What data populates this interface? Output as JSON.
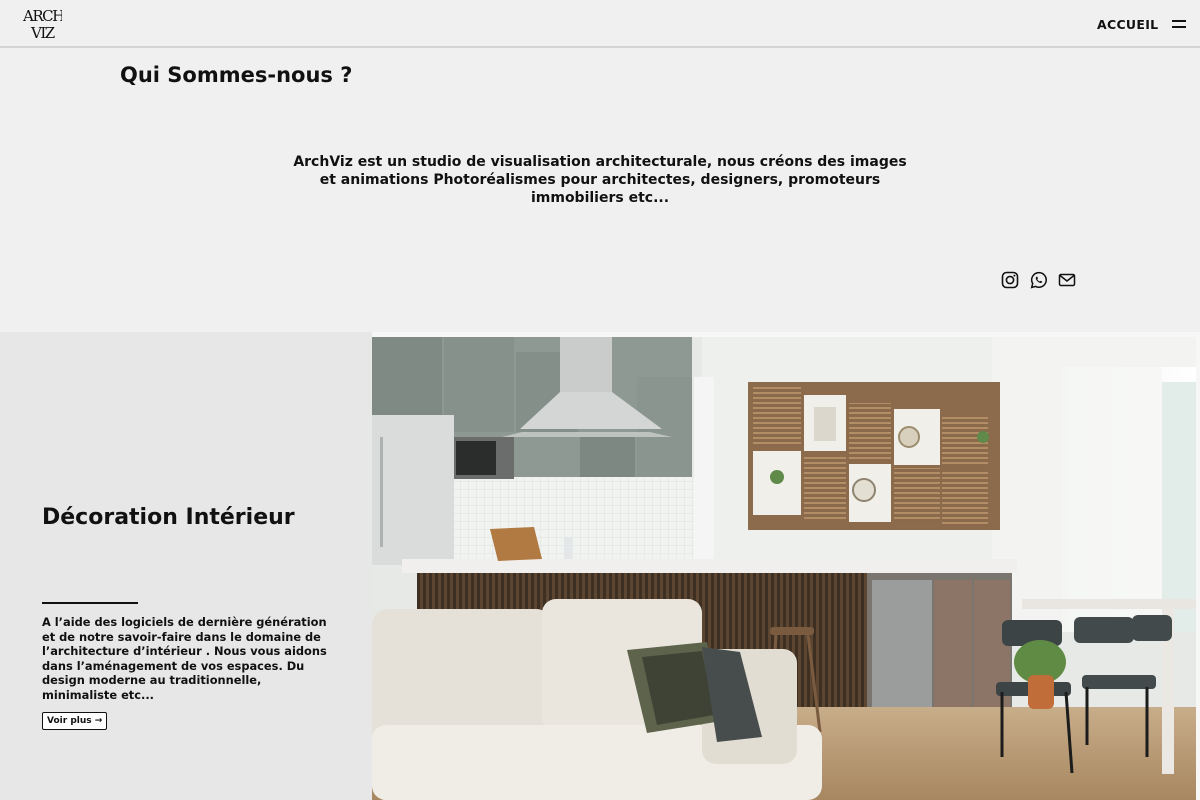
{
  "header": {
    "logo_text": "ARCH VIZ",
    "nav_link": "ACCUEIL",
    "menu_icon": "hamburger-icon"
  },
  "about": {
    "title": "Qui Sommes-nous ?",
    "text_lines": [
      "ArchViz est un studio de visualisation architecturale, nous créons des images",
      "et animations Photoréalismes pour architectes, designers, promoteurs",
      "immobiliers etc..."
    ],
    "social_icons": [
      "instagram-icon",
      "whatsapp-icon",
      "mail-icon"
    ]
  },
  "services": {
    "title": "Décoration Intérieur",
    "text_lines": [
      "A l’aide des logiciels de dernière génération",
      "et de notre savoir-faire dans le domaine de",
      "l’architecture d’intérieur . Nous vous aidons",
      "dans l’aménagement de vos espaces. Du",
      "design moderne au traditionnelle,",
      "minimaliste etc..."
    ],
    "button_label": "Voir plus →"
  }
}
